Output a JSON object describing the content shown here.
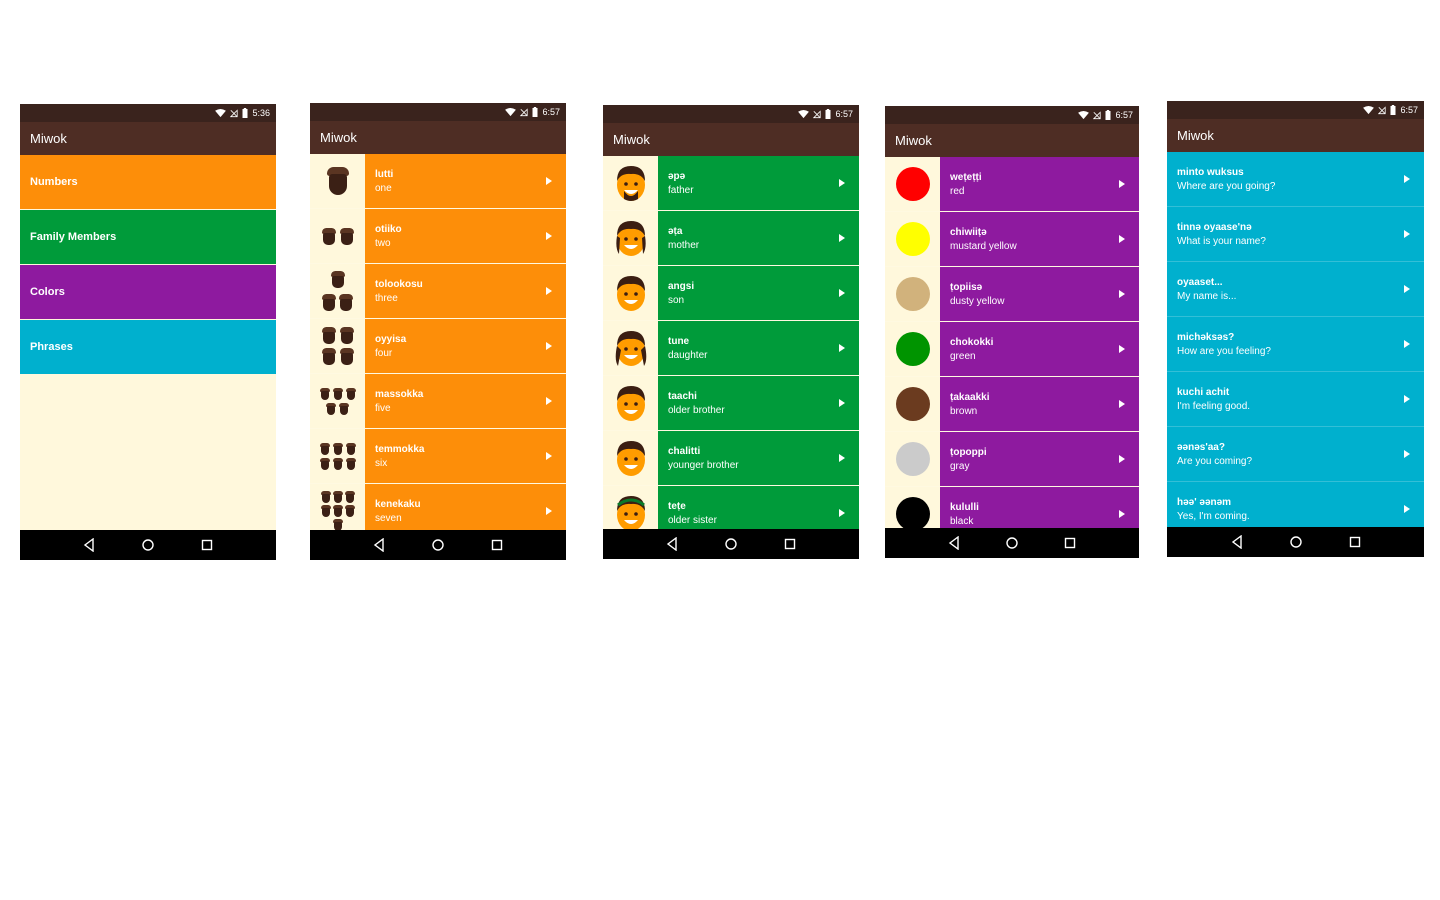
{
  "app_title": "Miwok",
  "colors": {
    "status_bar": "#3a231d",
    "app_bar": "#4e2d24",
    "numbers": "#fd8e09",
    "family": "#009b3a",
    "colors": "#8e1a9f",
    "phrases": "#00b0ce",
    "background": "#fff8dc"
  },
  "phones": [
    {
      "time": "5:36",
      "categories": [
        {
          "label": "Numbers",
          "color": "#fd8e09"
        },
        {
          "label": "Family Members",
          "color": "#009b3a"
        },
        {
          "label": "Colors",
          "color": "#8e1a9f"
        },
        {
          "label": "Phrases",
          "color": "#00b0ce"
        }
      ]
    },
    {
      "time": "6:57",
      "items": [
        {
          "miwok": "lutti",
          "english": "one",
          "icon": "acorn-1-icon"
        },
        {
          "miwok": "otiiko",
          "english": "two",
          "icon": "acorn-2-icon"
        },
        {
          "miwok": "tolookosu",
          "english": "three",
          "icon": "acorn-3-icon"
        },
        {
          "miwok": "oyyisa",
          "english": "four",
          "icon": "acorn-4-icon"
        },
        {
          "miwok": "massokka",
          "english": "five",
          "icon": "acorn-5-icon"
        },
        {
          "miwok": "temmokka",
          "english": "six",
          "icon": "acorn-6-icon"
        },
        {
          "miwok": "kenekaku",
          "english": "seven",
          "icon": "acorn-7-icon"
        }
      ]
    },
    {
      "time": "6:57",
      "items": [
        {
          "miwok": "әpә",
          "english": "father",
          "icon": "father-icon"
        },
        {
          "miwok": "әṭa",
          "english": "mother",
          "icon": "mother-icon"
        },
        {
          "miwok": "angsi",
          "english": "son",
          "icon": "son-icon"
        },
        {
          "miwok": "tune",
          "english": "daughter",
          "icon": "daughter-icon"
        },
        {
          "miwok": "taachi",
          "english": "older brother",
          "icon": "older-brother-icon"
        },
        {
          "miwok": "chalitti",
          "english": "younger brother",
          "icon": "younger-brother-icon"
        },
        {
          "miwok": "teṭe",
          "english": "older sister",
          "icon": "older-sister-icon"
        }
      ]
    },
    {
      "time": "6:57",
      "items": [
        {
          "miwok": "weṭeṭṭi",
          "english": "red",
          "swatch": "#ff0000"
        },
        {
          "miwok": "chiwiiṭә",
          "english": "mustard yellow",
          "swatch": "#ffff00"
        },
        {
          "miwok": "ṭopiisә",
          "english": "dusty yellow",
          "swatch": "#d1b27c"
        },
        {
          "miwok": "chokokki",
          "english": "green",
          "swatch": "#009400"
        },
        {
          "miwok": "ṭakaakki",
          "english": "brown",
          "swatch": "#6b3b1f"
        },
        {
          "miwok": "ṭopoppi",
          "english": "gray",
          "swatch": "#cbcbcb"
        },
        {
          "miwok": "kululli",
          "english": "black",
          "swatch": "#000000"
        }
      ]
    },
    {
      "time": "6:57",
      "items": [
        {
          "miwok": "minto wuksus",
          "english": "Where are you going?"
        },
        {
          "miwok": "tinnә oyaase'nә",
          "english": "What is your name?"
        },
        {
          "miwok": "oyaaset...",
          "english": "My name is..."
        },
        {
          "miwok": "michәksәs?",
          "english": "How are you feeling?"
        },
        {
          "miwok": "kuchi achit",
          "english": "I'm feeling good."
        },
        {
          "miwok": "әәnәs'aa?",
          "english": "Are you coming?"
        },
        {
          "miwok": "hәә' әәnәm",
          "english": "Yes, I'm coming."
        }
      ]
    }
  ]
}
